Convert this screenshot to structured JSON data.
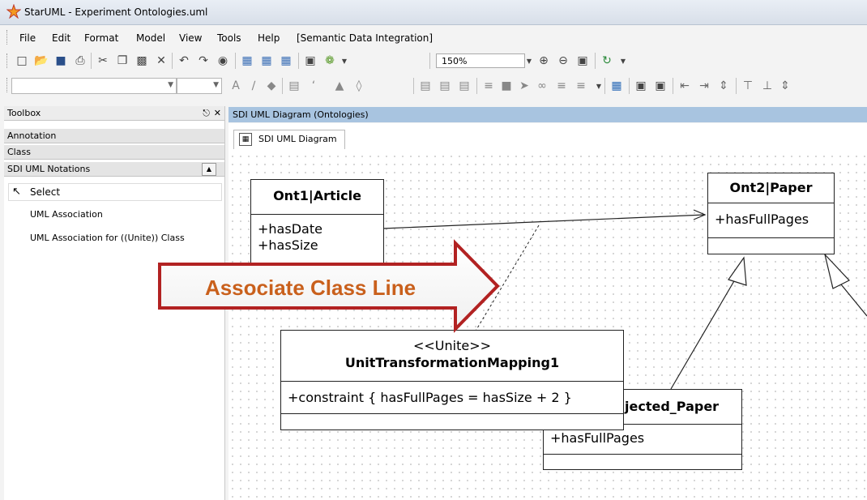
{
  "window": {
    "title": "StarUML - Experiment Ontologies.uml"
  },
  "menu": [
    "File",
    "Edit",
    "Format",
    "Model",
    "View",
    "Tools",
    "Help",
    "[Semantic Data Integration]"
  ],
  "toolbar": {
    "zoom_value": "150%"
  },
  "toolbox": {
    "title": "Toolbox",
    "sections": [
      "Annotation",
      "Class",
      "SDI UML Notations"
    ],
    "items": [
      "Select",
      "UML Association",
      "UML Association for ((Unite)) Class"
    ]
  },
  "diagram": {
    "header": "SDI UML Diagram (Ontologies)",
    "tab_label": "SDI UML Diagram",
    "classes": {
      "article": {
        "name": "Ont1|Article",
        "attrs": [
          "+hasDate",
          "+hasSize"
        ]
      },
      "paper": {
        "name": "Ont2|Paper",
        "attrs": [
          "+hasFullPages"
        ]
      },
      "mapping": {
        "stereotype": "<<Unite>>",
        "name": "UnitTransformationMapping1",
        "attrs": [
          "+constraint { hasFullPages = hasSize + 2 }"
        ]
      },
      "rejected": {
        "name": "jected_Paper",
        "attrs": [
          "+hasFullPages"
        ]
      }
    },
    "callout": "Associate Class Line"
  },
  "colors": {
    "callout_text": "#c9601c",
    "callout_border": "#b22222",
    "diagram_header": "#a8c4e0"
  }
}
